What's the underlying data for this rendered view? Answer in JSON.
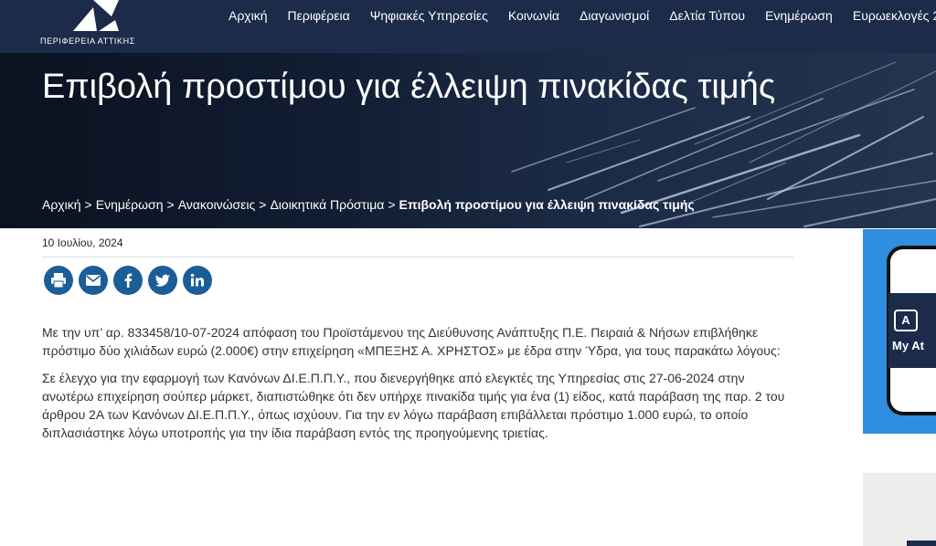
{
  "header": {
    "logo_text": "ΠΕΡΙΦΕΡΕΙΑ ΑΤΤΙΚΗΣ",
    "nav": [
      {
        "label": "Αρχική"
      },
      {
        "label": "Περιφέρεια"
      },
      {
        "label": "Ψηφιακές Υπηρεσίες"
      },
      {
        "label": "Κοινωνία"
      },
      {
        "label": "Διαγωνισμοί"
      },
      {
        "label": "Δελτία Τύπου"
      },
      {
        "label": "Ενημέρωση"
      },
      {
        "label": "Ευρωεκλογές 2"
      }
    ]
  },
  "hero": {
    "title": "Επιβολή προστίμου για έλλειψη πινακίδας τιμής"
  },
  "breadcrumb": {
    "items": [
      "Αρχική",
      "Ενημέρωση",
      "Ανακοινώσεις",
      "Διοικητικά Πρόστιμα"
    ],
    "separator": ">",
    "current": "Επιβολή προστίμου για έλλειψη πινακίδας τιμής"
  },
  "article": {
    "date": "10 Ιουλίου, 2024",
    "share": [
      {
        "name": "print-icon"
      },
      {
        "name": "email-icon"
      },
      {
        "name": "facebook-icon"
      },
      {
        "name": "twitter-icon"
      },
      {
        "name": "linkedin-icon"
      }
    ],
    "paragraphs": [
      "Με την υπ’ αρ. 833458/10-07-2024 απόφαση του Προϊστάμενου της Διεύθυνσης Ανάπτυξης Π.Ε. Πειραιά & Νήσων επιβλήθηκε πρόστιμο δύο χιλιάδων ευρώ (2.000€) στην επιχείρηση «ΜΠΕΞΗΣ Α. ΧΡΗΣΤΟΣ» με έδρα στην Ύδρα, για τους παρακάτω λόγους:",
      "Σε έλεγχο για την εφαρμογή των Κανόνων ΔΙ.Ε.Π.Π.Υ., που διενεργήθηκε από ελεγκτές της Υπηρεσίας στις 27-06-2024 στην ανωτέρω επιχείρηση σούπερ μάρκετ, διαπιστώθηκε ότι δεν υπήρχε πινακίδα τιμής για ένα (1) είδος, κατά παράβαση της παρ. 2 του άρθρου 2Α των Κανόνων ΔΙ.Ε.Π.Π.Υ., όπως ισχύουν. Για την εν λόγω παράβαση επιβάλλεται πρόστιμο 1.000 ευρώ, το οποίο διπλασιάστηκε λόγω υποτροπής για την ίδια παράβαση εντός της προηγούμενης τριετίας."
    ]
  },
  "sidebar": {
    "app_icon_letter": "A",
    "app_label": "My At"
  },
  "colors": {
    "navbar": "#1c2b4a",
    "share_icons": "#1b5e97",
    "side_banner": "#2f8ee0"
  }
}
